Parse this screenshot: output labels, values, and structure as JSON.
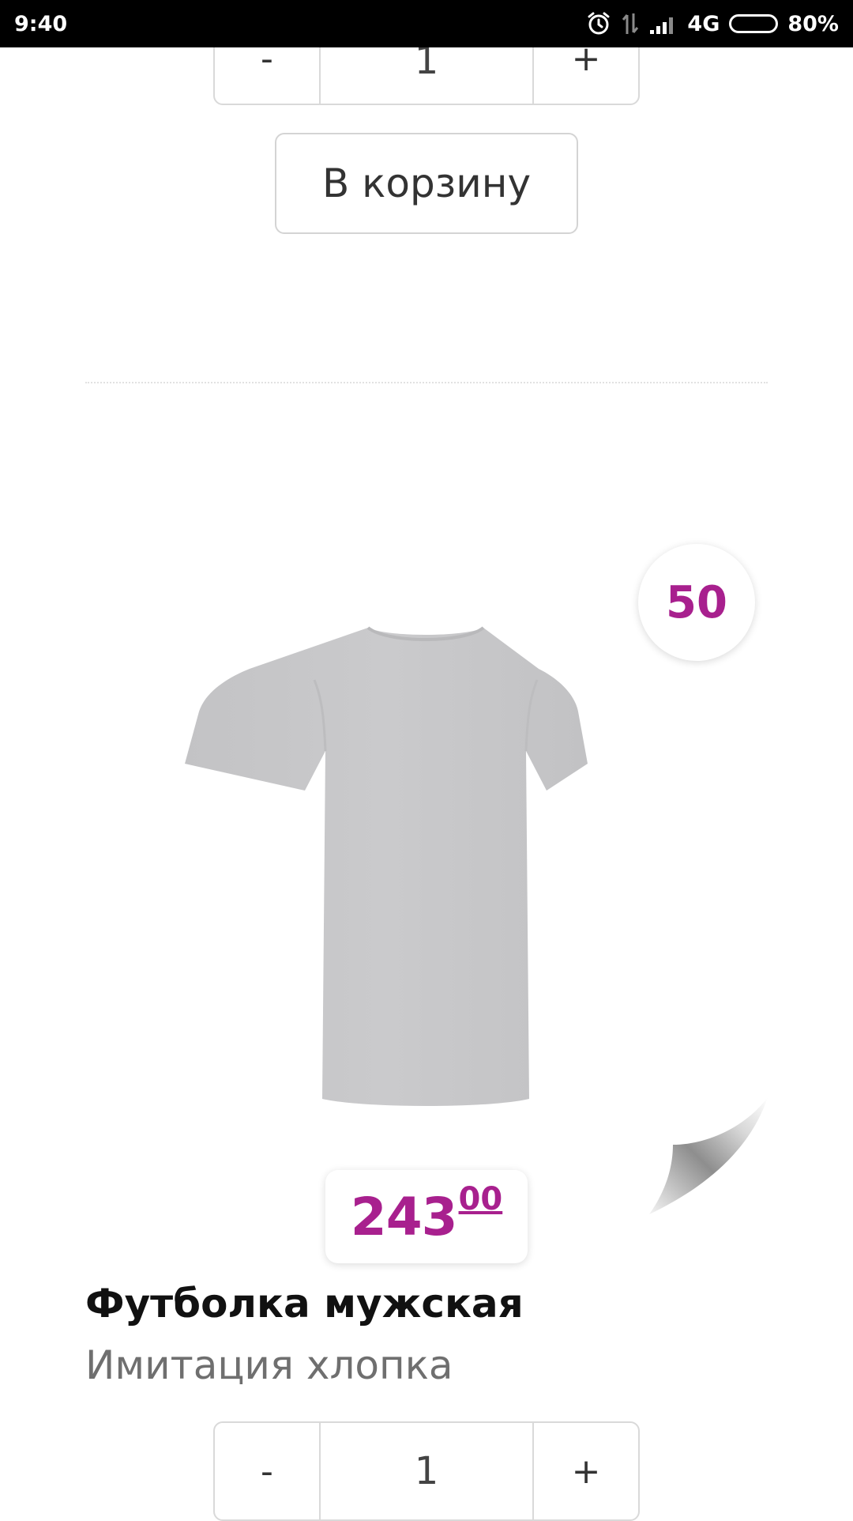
{
  "status_bar": {
    "time": "9:40",
    "network": "4G",
    "battery": "80%",
    "battery_level": 0.8,
    "icons": [
      "alarm-icon",
      "data-arrows-icon",
      "signal-icon",
      "battery-icon"
    ]
  },
  "products": [
    {
      "quantity": "1",
      "minus_label": "-",
      "plus_label": "+",
      "cart_label": "В корзину"
    },
    {
      "badge": "50",
      "price_int": "243",
      "price_frac": "00",
      "title": "Футболка мужская",
      "subtitle": "Имитация хлопка",
      "quantity": "1",
      "minus_label": "-",
      "plus_label": "+"
    }
  ],
  "colors": {
    "accent": "#a8208e",
    "tshirt": "#c8c8ca",
    "border": "#d9d9d9"
  }
}
